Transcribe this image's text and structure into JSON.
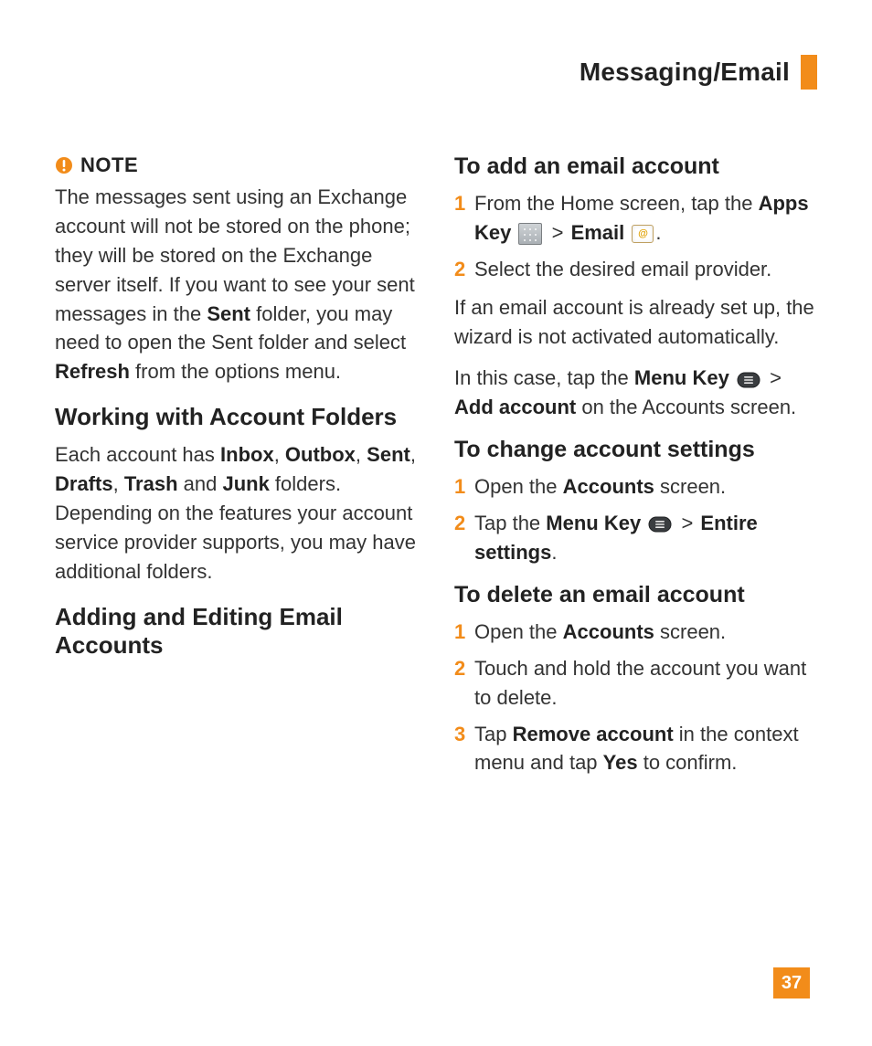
{
  "header": {
    "title": "Messaging/Email"
  },
  "note": {
    "label": "NOTE",
    "p1_a": "The messages sent using an Exchange account will not be stored on the phone; they will be stored on the Exchange server itself. If you want to see your sent messages in the ",
    "p1_b_bold": "Sent",
    "p1_c": " folder, you may need to open the Sent folder and select ",
    "p1_d_bold": "Refresh",
    "p1_e": " from the options menu."
  },
  "sec_folders": {
    "heading": "Working with Account Folders",
    "p_a": "Each account has ",
    "b_inbox": "Inbox",
    "sep1": ", ",
    "b_outbox": "Outbox",
    "sep2": ", ",
    "b_sent": "Sent",
    "sep3": ", ",
    "b_drafts": "Drafts",
    "sep4": ", ",
    "b_trash": "Trash",
    "and": " and ",
    "b_junk": "Junk",
    "p_b": " folders. Depending on the features your account service provider supports, you may have additional folders."
  },
  "sec_accounts": {
    "heading": "Adding and Editing Email Accounts"
  },
  "sub_add": {
    "heading": "To add an email account",
    "s1_a": "From the Home screen, tap the ",
    "s1_b_bold": "Apps Key",
    "s1_chev": " > ",
    "s1_email_bold": "Email",
    "s1_end": ".",
    "s2": "Select the desired email provider.",
    "p_after1": "If an email account is already set up, the wizard is not activated automatically.",
    "p2_a": " In this case, tap the ",
    "p2_menu_bold": "Menu Key",
    "p2_chev": " > ",
    "p2_add_bold": "Add account",
    "p2_b": " on the Accounts screen."
  },
  "sub_change": {
    "heading": "To change account settings",
    "s1_a": "Open the ",
    "s1_b_bold": "Accounts",
    "s1_c": " screen.",
    "s2_a": "Tap the ",
    "s2_menu_bold": "Menu Key",
    "s2_chev": " > ",
    "s2_entire_bold": "Entire settings",
    "s2_end": "."
  },
  "sub_delete": {
    "heading": "To delete an email account",
    "s1_a": "Open the ",
    "s1_b_bold": "Accounts",
    "s1_c": " screen.",
    "s2": "Touch and hold the account you want to delete.",
    "s3_a": "Tap ",
    "s3_b_bold": "Remove account",
    "s3_c": " in the context menu and tap ",
    "s3_d_bold": "Yes",
    "s3_e": " to confirm."
  },
  "page_number": "37"
}
